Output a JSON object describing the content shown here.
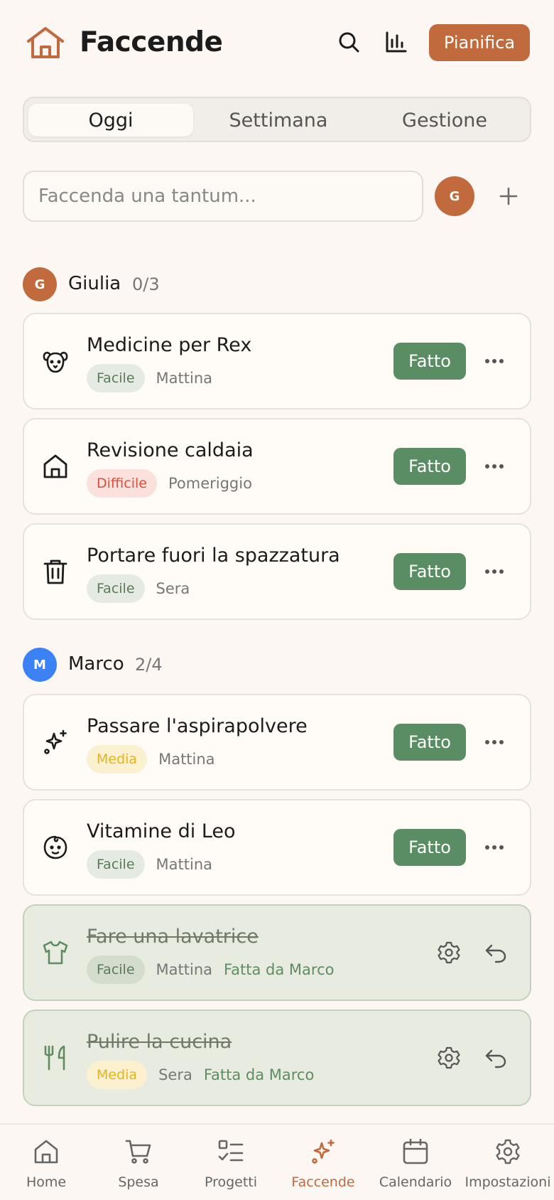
{
  "header": {
    "title": "Faccende",
    "plan_label": "Pianifica",
    "icons": [
      "search-icon",
      "stats-icon"
    ]
  },
  "tabs": [
    {
      "label": "Oggi",
      "active": true
    },
    {
      "label": "Settimana",
      "active": false
    },
    {
      "label": "Gestione",
      "active": false
    }
  ],
  "quick_add": {
    "placeholder": "Faccenda una tantum...",
    "assignee_initial": "G",
    "add_icon": "plus-icon"
  },
  "groups": [
    {
      "initial": "G",
      "name": "Giulia",
      "count": "0/3",
      "color": "#c06a3e",
      "chores": [
        {
          "title": "Medicine per Rex",
          "difficulty": "Facile",
          "time": "Mattina",
          "icon": "dog-icon",
          "done": false
        },
        {
          "title": "Revisione caldaia",
          "difficulty": "Difficile",
          "time": "Pomeriggio",
          "icon": "home-icon",
          "done": false
        },
        {
          "title": "Portare fuori la spazzatura",
          "difficulty": "Facile",
          "time": "Sera",
          "icon": "trash-icon",
          "done": false
        }
      ]
    },
    {
      "initial": "M",
      "name": "Marco",
      "count": "2/4",
      "color": "#3b82f6",
      "chores": [
        {
          "title": "Passare l'aspirapolvere",
          "difficulty": "Media",
          "time": "Mattina",
          "icon": "sparkles-icon",
          "done": false
        },
        {
          "title": "Vitamine di Leo",
          "difficulty": "Facile",
          "time": "Mattina",
          "icon": "baby-icon",
          "done": false
        },
        {
          "title": "Fare una lavatrice",
          "difficulty": "Facile",
          "time": "Mattina",
          "icon": "shirt-icon",
          "done": true,
          "done_by": "Fatta da Marco"
        },
        {
          "title": "Pulire la cucina",
          "difficulty": "Media",
          "time": "Sera",
          "icon": "utensils-icon",
          "done": true,
          "done_by": "Fatta da Marco"
        }
      ]
    }
  ],
  "done_button_label": "Fatto",
  "colors": {
    "accent": "#c06a3e",
    "done_green": "#5b8d65",
    "background": "#fcf7f2"
  },
  "bottom_nav": [
    {
      "label": "Home",
      "icon": "home-icon",
      "active": false
    },
    {
      "label": "Spesa",
      "icon": "cart-icon",
      "active": false
    },
    {
      "label": "Progetti",
      "icon": "list-check-icon",
      "active": false
    },
    {
      "label": "Faccende",
      "icon": "sparkles-icon",
      "active": true
    },
    {
      "label": "Calendario",
      "icon": "calendar-icon",
      "active": false
    },
    {
      "label": "Impostazioni",
      "icon": "gear-icon",
      "active": false
    }
  ]
}
